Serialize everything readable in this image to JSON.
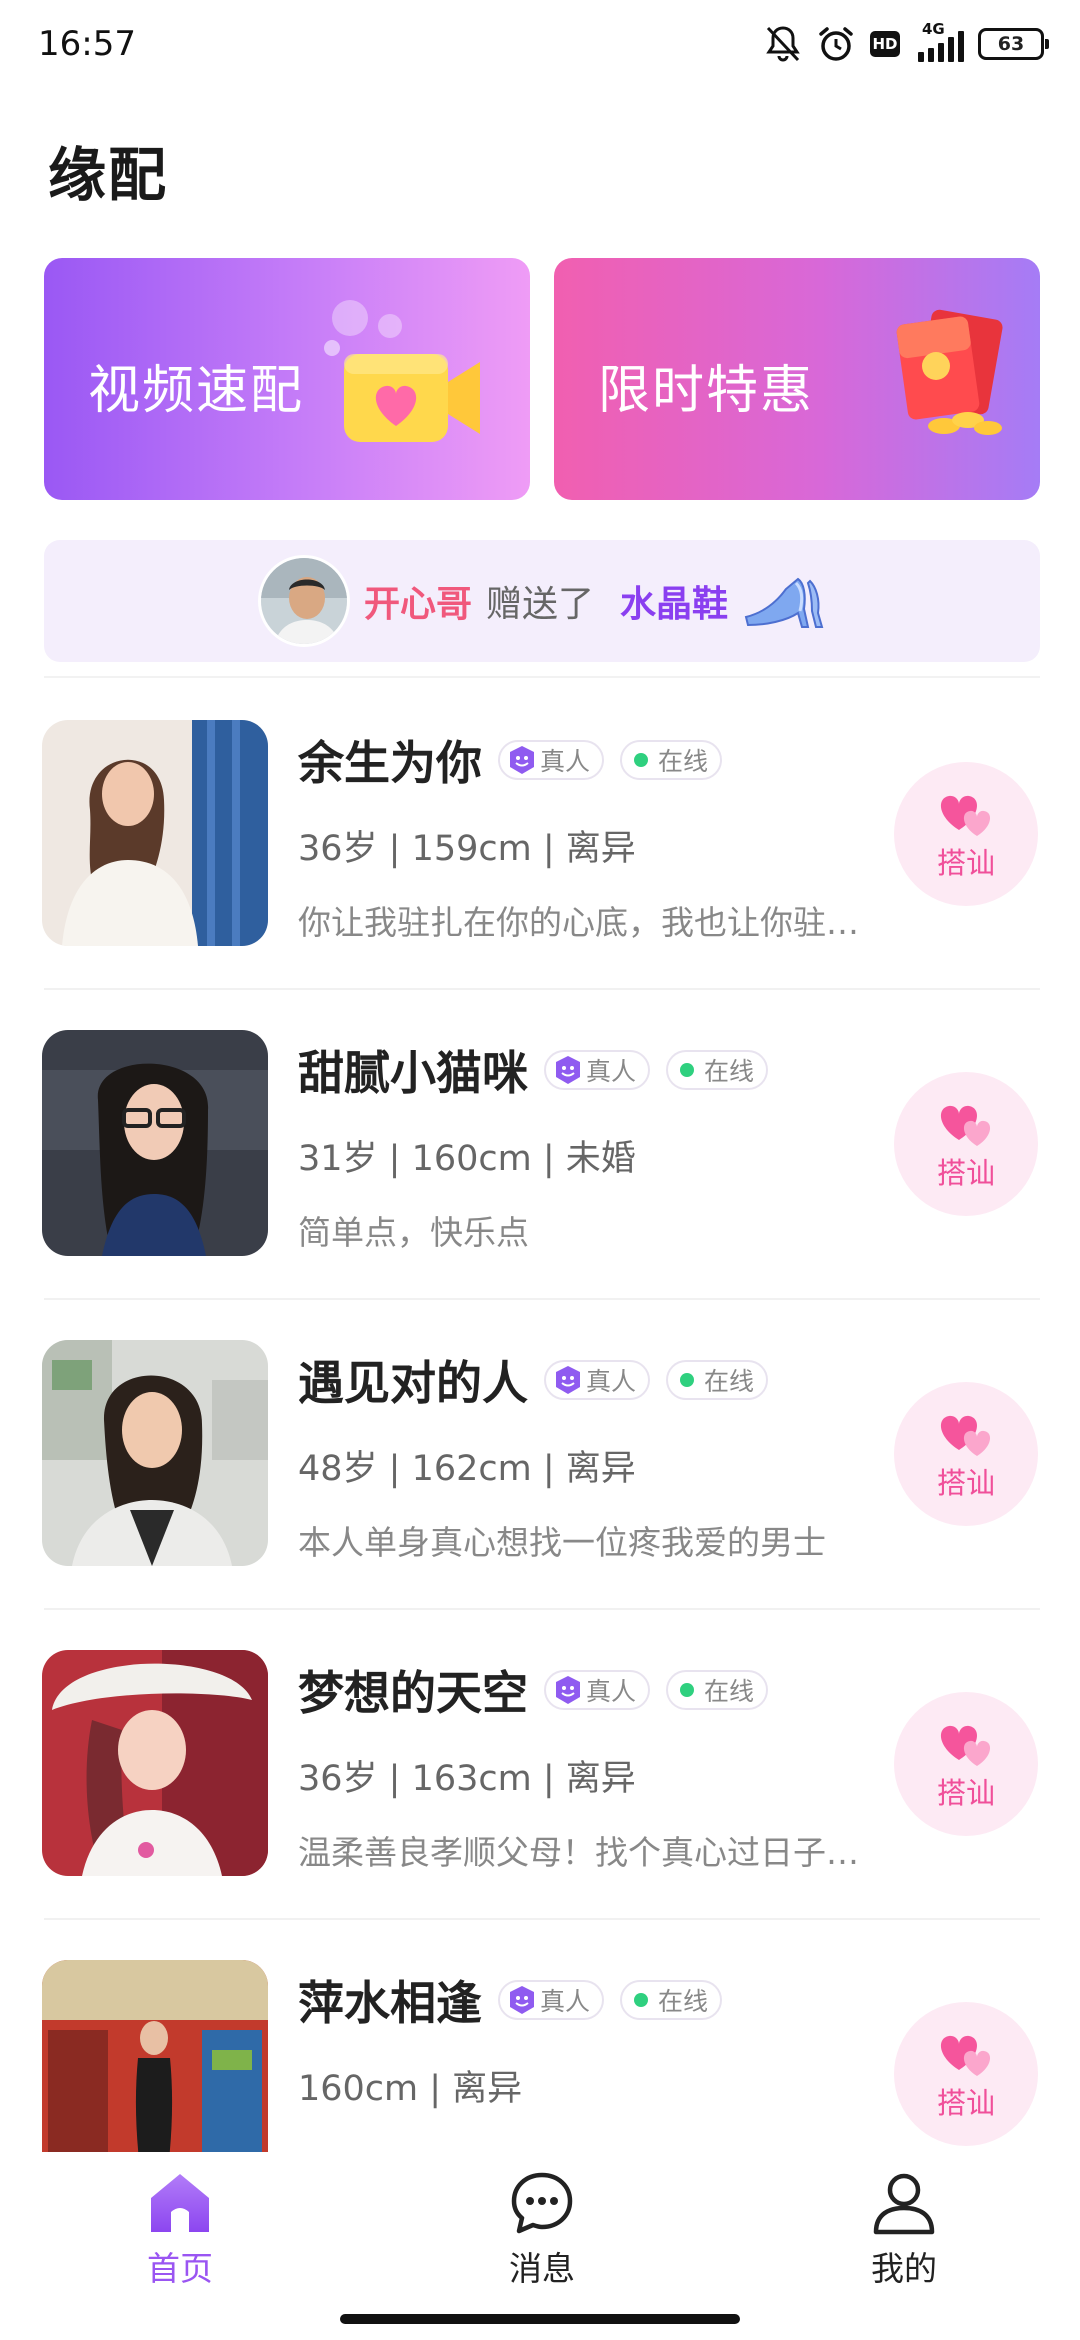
{
  "status_bar": {
    "time": "16:57",
    "network": "4G",
    "hd": "HD",
    "battery": "63",
    "icons": [
      "bell-off-icon",
      "alarm-icon",
      "hd-icon",
      "signal-icon",
      "battery-icon"
    ]
  },
  "page_title": "缘配",
  "banners": [
    {
      "label": "视频速配",
      "icon": "video-camera-heart-icon"
    },
    {
      "label": "限时特惠",
      "icon": "red-envelope-icon"
    }
  ],
  "gift_notice": {
    "sender": "开心哥",
    "verb": "赠送了",
    "item": "水晶鞋",
    "item_icon": "crystal-shoe-icon"
  },
  "badges": {
    "verified": "真人",
    "online": "在线"
  },
  "chat_button_label": "搭讪",
  "users": [
    {
      "name": "余生为你",
      "info": "36岁 | 159cm  | 离异",
      "bio": "你让我驻扎在你的心底，我也让你驻扎在我的心底"
    },
    {
      "name": "甜腻小猫咪",
      "info": "31岁 | 160cm  | 未婚",
      "bio": "简单点，快乐点"
    },
    {
      "name": "遇见对的人",
      "info": "48岁 | 162cm  | 离异",
      "bio": "本人单身真心想找一位疼我爱的男士"
    },
    {
      "name": "梦想的天空",
      "info": "36岁 | 163cm  | 离异",
      "bio": "温柔善良孝顺父母！找个真心过日子的人"
    },
    {
      "name": "萍水相逢",
      "info": " 160cm  | 离异",
      "bio": ""
    }
  ],
  "bottom_nav": [
    {
      "label": "首页",
      "icon": "home-icon",
      "active": true
    },
    {
      "label": "消息",
      "icon": "message-icon",
      "active": false
    },
    {
      "label": "我的",
      "icon": "profile-icon",
      "active": false
    }
  ],
  "colors": {
    "accent_purple": "#9a55f2",
    "accent_pink": "#f0509a",
    "online_green": "#2fd07f",
    "gift_sender": "#f0587c",
    "gift_item": "#8a3ff0"
  }
}
